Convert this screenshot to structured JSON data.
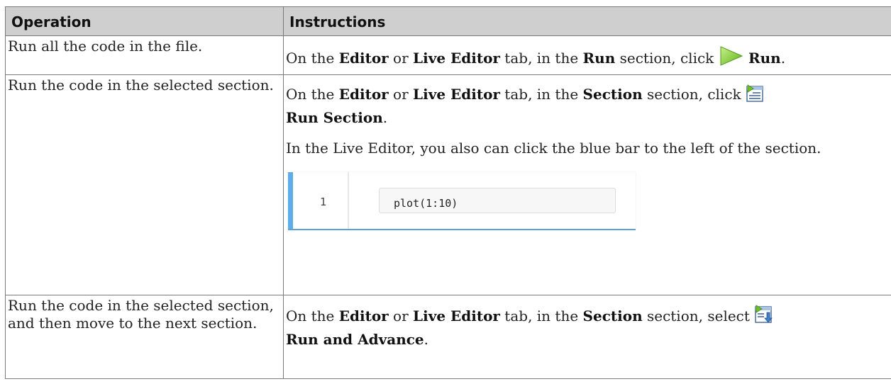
{
  "table": {
    "headers": {
      "operation": "Operation",
      "instructions": "Instructions"
    },
    "rows": [
      {
        "operation": "Run all the code in the file.",
        "p1_prefix": "On the ",
        "p1_b1": "Editor",
        "p1_mid1": " or ",
        "p1_b2": "Live Editor",
        "p1_mid2": " tab, in the ",
        "p1_b3": "Run",
        "p1_mid3": " section, click ",
        "p1_b4": "Run",
        "p1_end": ".",
        "icon": "run-icon"
      },
      {
        "operation": "Run the code in the selected section.",
        "p1_prefix": "On the ",
        "p1_b1": "Editor",
        "p1_mid1": " or ",
        "p1_b2": "Live Editor",
        "p1_mid2": " tab, in the ",
        "p1_b3": "Section",
        "p1_mid3": " section, click ",
        "p1_b4": "Run Section",
        "p1_end": ".",
        "icon": "run-section-icon",
        "p2": "In the Live Editor, you also can click the blue bar to the left of the section.",
        "code_line_number": "1",
        "code_text": "plot(1:10)"
      },
      {
        "operation": "Run the code in the selected section, and then move to the next section.",
        "p1_prefix": "On the ",
        "p1_b1": "Editor",
        "p1_mid1": " or ",
        "p1_b2": "Live Editor",
        "p1_mid2": " tab, in the ",
        "p1_b3": "Section",
        "p1_mid3": " section, select ",
        "p1_b4": "Run and Advance",
        "p1_end": ".",
        "icon": "run-and-advance-icon"
      }
    ]
  },
  "colors": {
    "header_bg": "#cfcfcf",
    "border": "#7a7a7a",
    "run_icon": "#7ed321",
    "section_bar": "#5aaef0"
  }
}
